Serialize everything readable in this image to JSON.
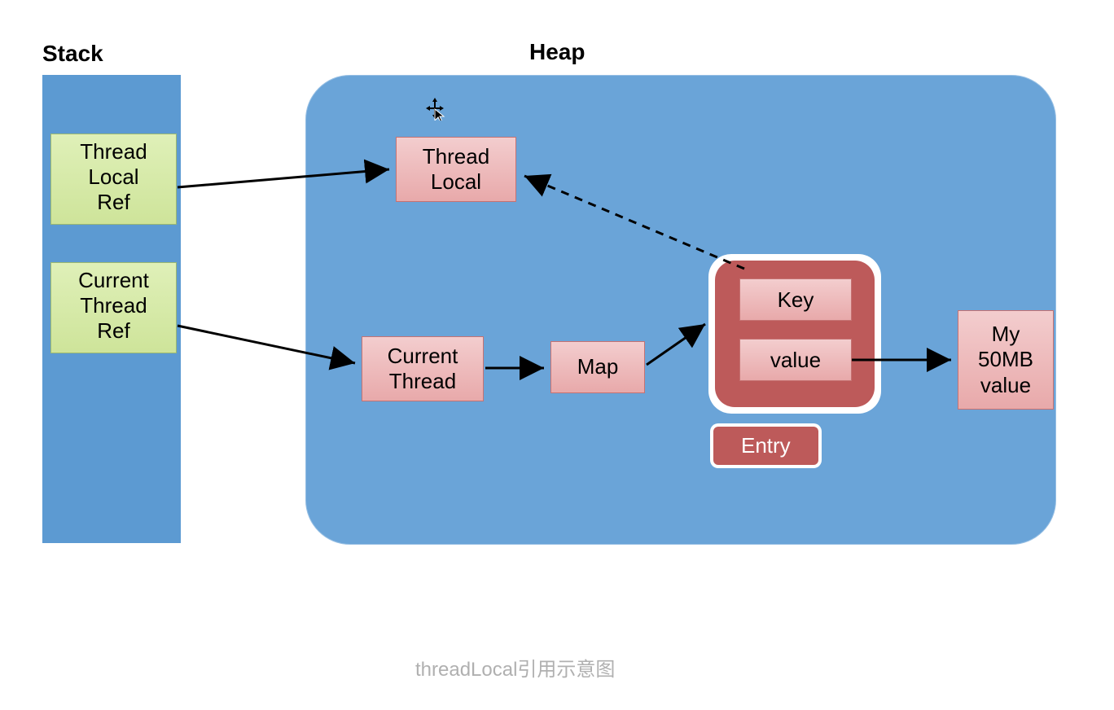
{
  "labels": {
    "stack": "Stack",
    "heap": "Heap"
  },
  "stack": {
    "tlref": "Thread\nLocal\nRef",
    "ctref": "Current\nThread\nRef"
  },
  "heap": {
    "threadlocal": "Thread\nLocal",
    "currentthread": "Current\nThread",
    "map": "Map",
    "key": "Key",
    "value": "value",
    "entry": "Entry",
    "myvalue": "My\n50MB\nvalue"
  },
  "caption": "threadLocal引用示意图",
  "colors": {
    "stack_bg": "#5c9ad2",
    "heap_bg": "#6aa4d8",
    "green_box": "#cee49a",
    "pink_box": "#e8a9aa",
    "entry_bg": "#bd5a5a"
  }
}
